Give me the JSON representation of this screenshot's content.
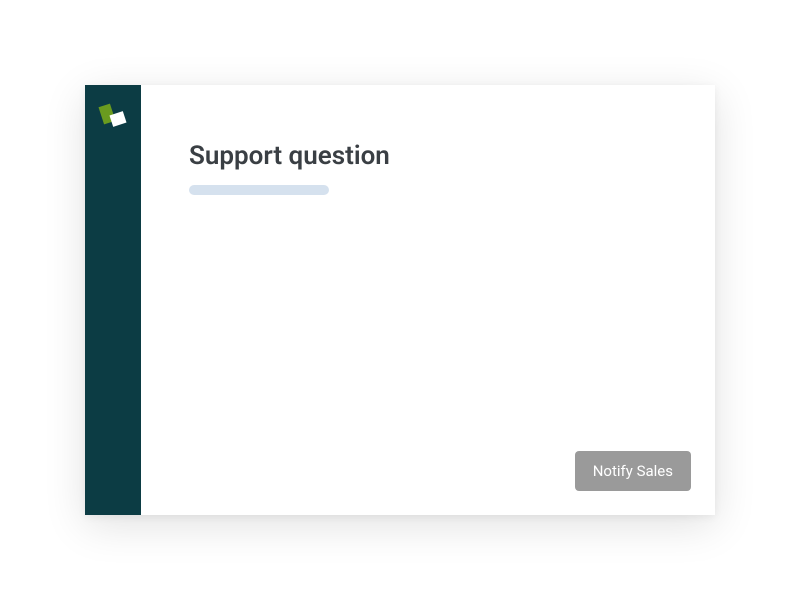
{
  "header": {
    "title": "Support question"
  },
  "actions": {
    "notify_label": "Notify Sales"
  }
}
